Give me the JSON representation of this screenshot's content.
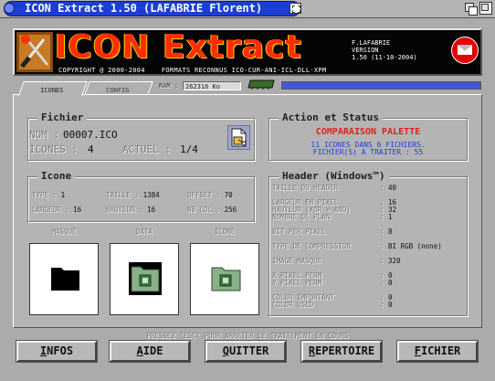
{
  "window": {
    "title": "ICON Extract 1.50 (LAFABRIE Florent)"
  },
  "banner": {
    "title": "ICON Extract",
    "copyright": "COPYRIGHT @ 2000-2004",
    "formats": "FORMATS RECONNUS ICO-CUR-ANI-ICL-DLL-XPM",
    "author": "F.LAFABRIE",
    "version_label": "VERSION",
    "version_value": "1.50 (11-10-2004)"
  },
  "tabs": [
    {
      "label": "ICONES",
      "active": true
    },
    {
      "label": "CONFIG",
      "active": false
    }
  ],
  "ram": {
    "label": "RAM :",
    "value": "262316 Ko"
  },
  "progress": {
    "fraction": 1.0
  },
  "fichier": {
    "title": "Fichier",
    "nom_label": "NOM :",
    "nom_value": "00007.ICO",
    "icones_label": "ICONES :",
    "icones_value": "4",
    "actuel_label": "ACTUEL :",
    "actuel_value": "1/4"
  },
  "action": {
    "title": "Action et Status",
    "status": "COMPARAISON PALETTE",
    "line1": "11 ICONES DANS 6 FICHIERS.",
    "line2": "FICHIER(S) A TRAITER : 55"
  },
  "icone": {
    "title": "Icone",
    "type_label": "TYPE :",
    "type_value": "1",
    "taille_label": "TAILLE :",
    "taille_value": "1384",
    "offset_label": "OFFSET :",
    "offset_value": "70",
    "largeur_label": "LARGEUR :",
    "largeur_value": "16",
    "hauteur_label": "HAUTEUR :",
    "hauteur_value": "16",
    "nbcol_label": "NB COL :",
    "nbcol_value": "256"
  },
  "header": {
    "title": "Header (Windows™)",
    "rows": [
      {
        "label": "TAILLE DU HEADER",
        "value": "40"
      },
      {
        "label": "LARGEUR EN PIXEL",
        "value": "16"
      },
      {
        "label": "HAUTEUR (XOR + AND)",
        "value": "32"
      },
      {
        "label": "NOMBRE DE PLAN",
        "value": "1"
      },
      {
        "label": "BIT PER PIXEL",
        "value": "8"
      },
      {
        "label": "TYPE DE COMPRESSION",
        "value": "BI RGB (none)"
      },
      {
        "label": "IMAGE MASQUE",
        "value": "320"
      },
      {
        "label": "X PIXEL PERM",
        "value": "0"
      },
      {
        "label": "Y PIXEL PERM",
        "value": "0"
      },
      {
        "label": "COLOR IMPORTANT",
        "value": "0"
      },
      {
        "label": "COLOR USED",
        "value": "0"
      }
    ]
  },
  "previews": {
    "masque_label": "MASQUE",
    "data_label": "DATA",
    "icone_label": "ICONE"
  },
  "status_message": "PRESSEZ \"ESC\" POUR ARRETER LE TRAITEMENT EN COURS",
  "buttons": {
    "infos_first": "I",
    "infos_rest": "NFOS",
    "aide_first": "A",
    "aide_rest": "IDE",
    "quitter_first": "Q",
    "quitter_rest": "UITTER",
    "repertoire_first": "R",
    "repertoire_rest": "EPERTOIRE",
    "fichier_first": "F",
    "fichier_rest": "ICHIER"
  },
  "colors": {
    "title_blue": "#1b3fd3",
    "status_red": "#e41e1e",
    "info_blue": "#1f3de0",
    "banner_red": "#ff2d00"
  }
}
